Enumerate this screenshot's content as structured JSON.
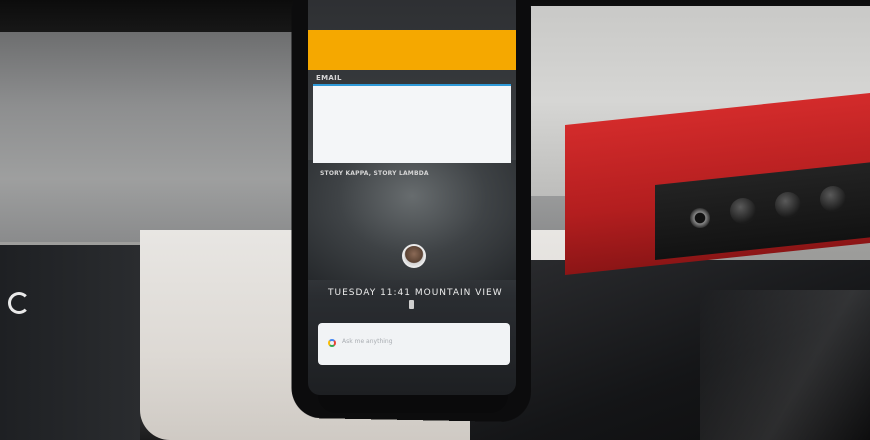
{
  "scene": {
    "description_icons": [
      "seagate-logo-icon",
      "google-g-icon",
      "battery-icon",
      "avatar"
    ]
  },
  "phone": {
    "email_label": "EMAIL",
    "story_label": "STORY KAPPA, STORY LAMBDA",
    "clock_line": "TUESDAY 11:41 MOUNTAIN VIEW",
    "search_placeholder": "Ask me anything"
  },
  "colors": {
    "accent_orange": "#f5a800",
    "focus_blue": "#2f9ad8",
    "device_red": "#d32b2b"
  }
}
